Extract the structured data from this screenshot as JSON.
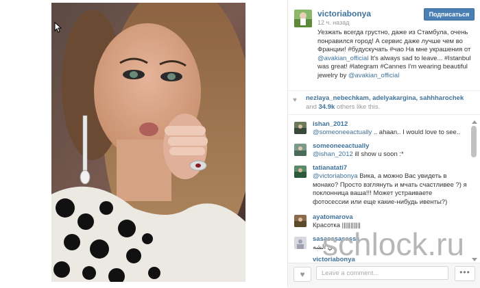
{
  "post": {
    "username": "victoriabonya",
    "time": "12 ч. назад",
    "follow_label": "Подписаться",
    "caption_part1": "Уезжать всегда грустно, даже из Стамбула, очень понравился город! А сервис даже лучше чем во Франции! #будускучать #чао На мне украшения от ",
    "caption_mention1": "@avakian_official",
    "caption_part2": " It's always sad to leave... #Istanbul was great! #lategram #Cannes I'm wearing beautiful jewelry by ",
    "caption_mention2": "@avakian_official"
  },
  "likes": {
    "names": "nezlaya_nebechkam, adelyakargina, sahhharochek",
    "and": "and",
    "count": "34.9k",
    "suffix": "others like this."
  },
  "comments": [
    {
      "user": "ishan_2012",
      "mention": "@someoneeactually",
      "text": " .. ahaan.. I would love to see.."
    },
    {
      "user": "someoneeactually",
      "mention": "@ishan_2012",
      "text": " ill show u soon :*"
    },
    {
      "user": "tatianatati7",
      "mention": "@victoriabonya",
      "text": " Вика, а можно Вас увидеть в монако? Просто взглянуть и мчать счастливее ?) я поклонница ваша!!! Может устраиваете фотосессии или еще какие-нибудь ивенты?)"
    },
    {
      "user": "ayatomarova",
      "mention": "",
      "text": "Красотка |||||||||||"
    },
    {
      "user": "sasasasasasss",
      "mention": "",
      "text": "ي الشه"
    },
    {
      "user": "victoriabonya",
      "mention": "",
      "text": ""
    }
  ],
  "footer": {
    "placeholder": "Leave a comment...",
    "more_label": "•••"
  },
  "watermark": "schlock.ru",
  "colors": {
    "link": "#3f729b",
    "follow_button": "#4a80b4"
  },
  "icons": {
    "like": "heart-icon",
    "likes_summary": "heart-icon",
    "more": "ellipsis-icon",
    "cursor": "mouse-pointer-icon"
  }
}
